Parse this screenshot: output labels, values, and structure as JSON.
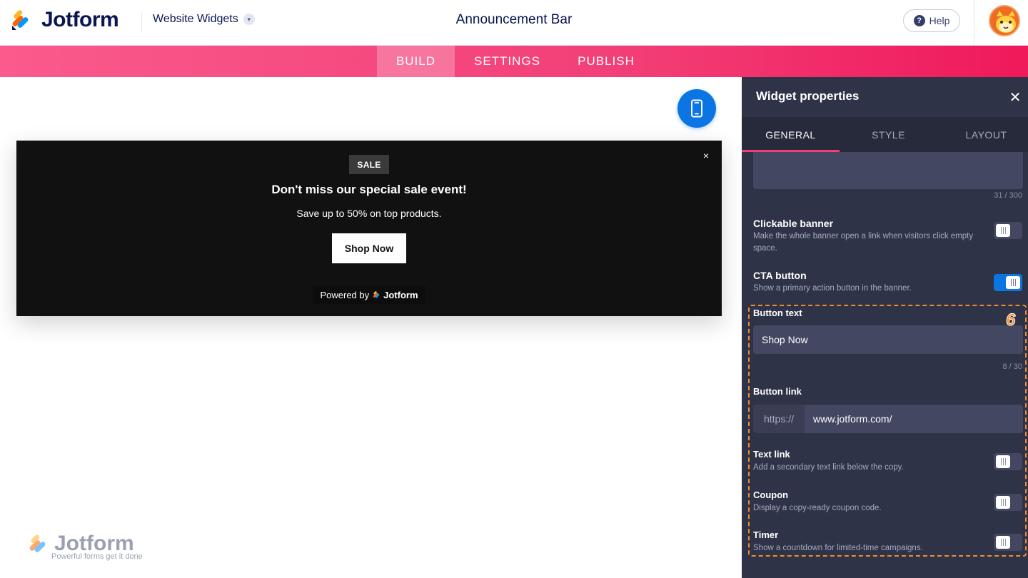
{
  "header": {
    "brand": "Jotform",
    "widgets_menu": "Website Widgets",
    "page_title": "Announcement Bar",
    "help_label": "Help"
  },
  "tabs": [
    "BUILD",
    "SETTINGS",
    "PUBLISH"
  ],
  "active_tab": "BUILD",
  "banner": {
    "badge": "SALE",
    "close_glyph": "×",
    "title": "Don't miss our special sale event!",
    "subtitle": "Save up to 50% on top products.",
    "cta": "Shop Now",
    "powered_prefix": "Powered by",
    "powered_brand": "Jotform"
  },
  "watermark": {
    "name": "Jotform",
    "tagline": "Powerful forms get it done"
  },
  "panel": {
    "title": "Widget properties",
    "close_glyph": "✕",
    "tabs": [
      "GENERAL",
      "STYLE",
      "LAYOUT"
    ],
    "active_tab": "GENERAL",
    "text_counter": "31 / 300",
    "clickable_banner": {
      "label": "Clickable banner",
      "desc": "Make the whole banner open a link when visitors click empty space.",
      "enabled": false
    },
    "cta_button": {
      "label": "CTA button",
      "desc": "Show a primary action button in the banner.",
      "enabled": true
    },
    "button_text": {
      "label": "Button text",
      "value": "Shop Now",
      "counter": "8 / 30"
    },
    "button_link": {
      "label": "Button link",
      "prefix": "https://",
      "value": "www.jotform.com/"
    },
    "text_link": {
      "label": "Text link",
      "desc": "Add a secondary text link below the copy.",
      "enabled": false
    },
    "coupon": {
      "label": "Coupon",
      "desc": "Display a copy-ready coupon code.",
      "enabled": false
    },
    "timer": {
      "label": "Timer",
      "desc": "Show a countdown for limited-time campaigns.",
      "enabled": false
    }
  },
  "annotation": {
    "step": "6"
  },
  "colors": {
    "brand_navy": "#0a1551",
    "tab_pink": "#f23f77",
    "panel_bg": "#2f3347",
    "accent_blue": "#0a75e3",
    "highlight_orange": "#f48b2c"
  }
}
